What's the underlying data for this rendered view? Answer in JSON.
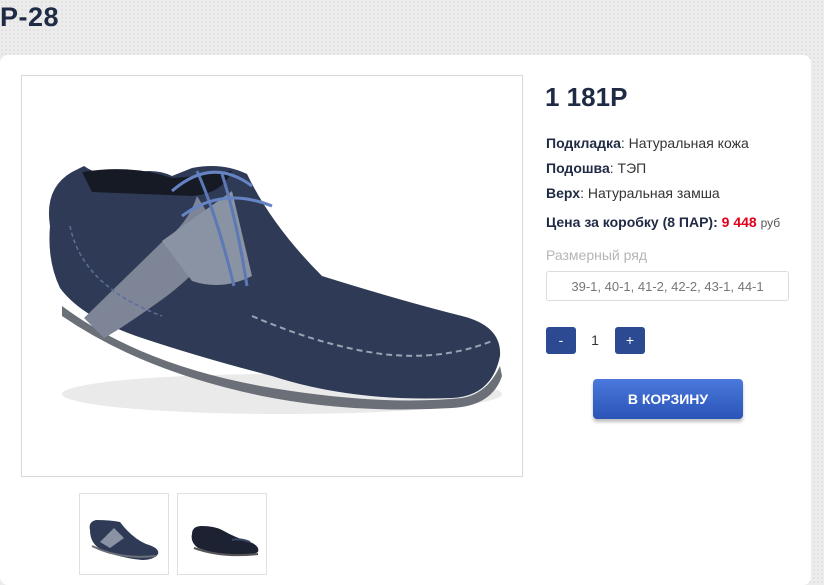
{
  "product": {
    "title": "P-28",
    "price": "1 181P"
  },
  "specs": [
    {
      "label": "Подкладка",
      "value": ": Натуральная кожа"
    },
    {
      "label": "Подошва",
      "value": ": ТЭП"
    },
    {
      "label": "Верх",
      "value": ": Натуральная замша"
    }
  ],
  "box": {
    "label": "Цена за коробку (8 ПАР):",
    "price": "9 448",
    "currency": "руб"
  },
  "sizes": {
    "label": "Размерный ряд",
    "selected": "39-1, 40-1, 41-2, 42-2, 43-1, 44-1"
  },
  "quantity": {
    "minus": "-",
    "value": "1",
    "plus": "+"
  },
  "cart": {
    "label": "В КОРЗИНУ"
  },
  "colors": {
    "accent": "#2c4a91",
    "price_red": "#e0001b",
    "shoe": "#2f3b56"
  }
}
